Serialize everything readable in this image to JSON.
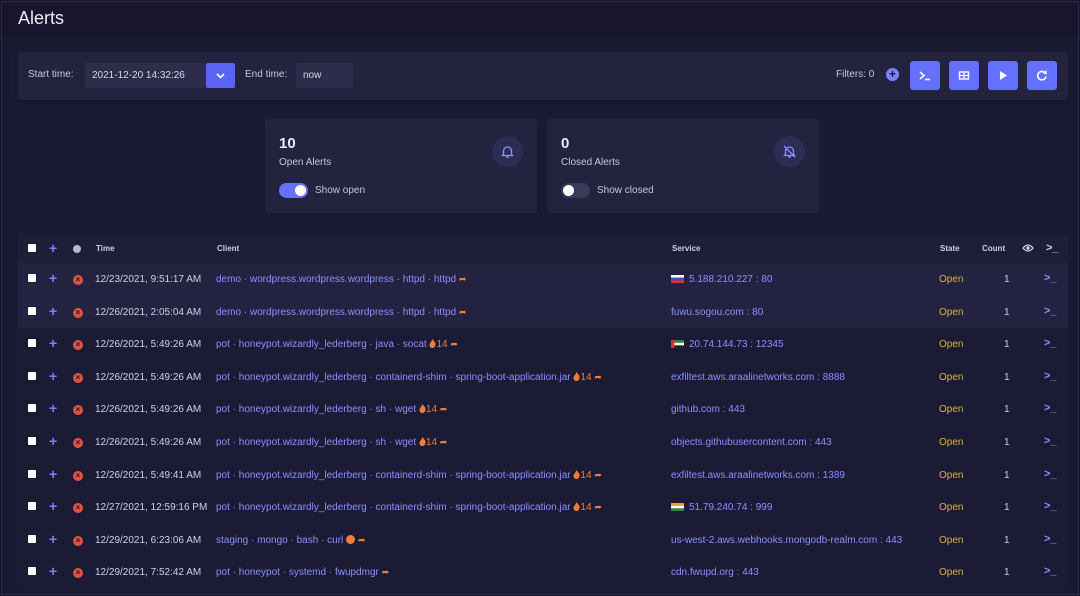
{
  "header": {
    "title": "Alerts"
  },
  "toolbar": {
    "start_label": "Start time:",
    "start_value": "2021-12-20 14:32:26",
    "end_label": "End time:",
    "end_value": "now",
    "filters_label": "Filters:",
    "filters_count": "0",
    "buttons": [
      "terminal-icon",
      "table-icon",
      "play-icon",
      "refresh-icon"
    ]
  },
  "cards": {
    "open": {
      "count": "10",
      "label": "Open Alerts",
      "toggle_label": "Show open",
      "toggle_on": true,
      "icon": "bell-icon"
    },
    "closed": {
      "count": "0",
      "label": "Closed Alerts",
      "toggle_label": "Show closed",
      "toggle_on": false,
      "icon": "bell-off-icon"
    }
  },
  "table": {
    "columns": {
      "time": "Time",
      "client": "Client",
      "service": "Service",
      "state": "State",
      "count": "Count"
    },
    "rows": [
      {
        "time": "12/23/2021, 9:51:17 AM",
        "client": "demo · wordpress.wordpress.wordpress · httpd · httpd",
        "hot": "",
        "service": "5.188.210.227 : 80",
        "flag": "ru",
        "state": "Open",
        "count": "1"
      },
      {
        "time": "12/26/2021, 2:05:04 AM",
        "client": "demo · wordpress.wordpress.wordpress · httpd · httpd",
        "hot": "",
        "service": "fuwu.sogou.com : 80",
        "flag": "",
        "state": "Open",
        "count": "1"
      },
      {
        "time": "12/26/2021, 5:49:26 AM",
        "client": "pot · honeypot.wizardly_lederberg · java · socat",
        "hot": "14",
        "service": "20.74.144.73 : 12345",
        "flag": "ae",
        "state": "Open",
        "count": "1"
      },
      {
        "time": "12/26/2021, 5:49:26 AM",
        "client": "pot · honeypot.wizardly_lederberg · containerd-shim · spring-boot-application.jar",
        "hot": "14",
        "service": "exfiltest.aws.araalinetworks.com : 8888",
        "flag": "",
        "state": "Open",
        "count": "1"
      },
      {
        "time": "12/26/2021, 5:49:26 AM",
        "client": "pot · honeypot.wizardly_lederberg · sh · wget",
        "hot": "14",
        "service": "github.com : 443",
        "flag": "",
        "state": "Open",
        "count": "1"
      },
      {
        "time": "12/26/2021, 5:49:26 AM",
        "client": "pot · honeypot.wizardly_lederberg · sh · wget",
        "hot": "14",
        "service": "objects.githubusercontent.com : 443",
        "flag": "",
        "state": "Open",
        "count": "1"
      },
      {
        "time": "12/26/2021, 5:49:41 AM",
        "client": "pot · honeypot.wizardly_lederberg · containerd-shim · spring-boot-application.jar",
        "hot": "14",
        "service": "exfiltest.aws.araalinetworks.com : 1389",
        "flag": "",
        "state": "Open",
        "count": "1"
      },
      {
        "time": "12/27/2021, 12:59:16 PM",
        "client": "pot · honeypot.wizardly_lederberg · containerd-shim · spring-boot-application.jar",
        "hot": "14",
        "service": "51.79.240.74 : 999",
        "flag": "in",
        "state": "Open",
        "count": "1"
      },
      {
        "time": "12/29/2021, 6:23:06 AM",
        "client": "staging · mongo · bash · curl",
        "hot": "",
        "service": "us-west-2.aws.webhooks.mongodb-realm.com : 443",
        "flag": "",
        "state": "Open",
        "count": "1"
      },
      {
        "time": "12/29/2021, 7:52:42 AM",
        "client": "pot · honeypot · systemd · fwupdmgr",
        "hot": "",
        "service": "cdn.fwupd.org : 443",
        "flag": "",
        "state": "Open",
        "count": "1"
      }
    ]
  }
}
